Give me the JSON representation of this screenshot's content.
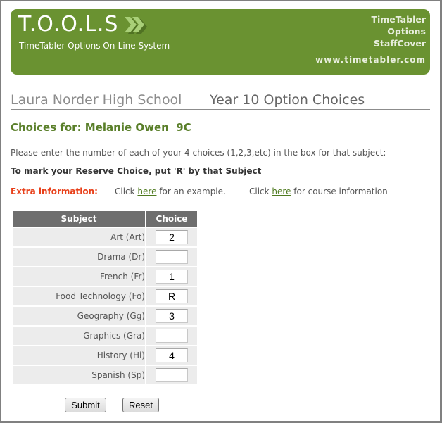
{
  "header": {
    "logo": "T.O.O.L.S",
    "logo_icon": "double-chevron-right-icon",
    "tagline": "TimeTabler Options On-Line System",
    "products": [
      "TimeTabler",
      "Options",
      "StaffCover"
    ],
    "website": "www.timetabler.com",
    "brand_color": "#6a9231"
  },
  "titles": {
    "school": "Laura Norder High School",
    "page": "Year 10 Option Choices"
  },
  "student": {
    "heading": "Choices for: Melanie Owen  9C"
  },
  "instructions": {
    "line1": "Please enter the number of each of your 4 choices (1,2,3,etc) in the box for that subject:",
    "line2": "To mark your Reserve Choice, put 'R' by that Subject",
    "extra_label": "Extra information:",
    "extra1_pre": "Click ",
    "extra1_link": "here",
    "extra1_post": " for an example.",
    "extra2_pre": "Click ",
    "extra2_link": "here",
    "extra2_post": " for course information"
  },
  "table": {
    "headers": [
      "Subject",
      "Choice"
    ],
    "rows": [
      {
        "subject": "Art (Art)",
        "choice": "2"
      },
      {
        "subject": "Drama (Dr)",
        "choice": ""
      },
      {
        "subject": "French (Fr)",
        "choice": "1"
      },
      {
        "subject": "Food Technology (Fo)",
        "choice": "R"
      },
      {
        "subject": "Geography (Gg)",
        "choice": "3"
      },
      {
        "subject": "Graphics (Gra)",
        "choice": ""
      },
      {
        "subject": "History (Hi)",
        "choice": "4"
      },
      {
        "subject": "Spanish (Sp)",
        "choice": ""
      }
    ]
  },
  "buttons": {
    "submit": "Submit",
    "reset": "Reset"
  }
}
